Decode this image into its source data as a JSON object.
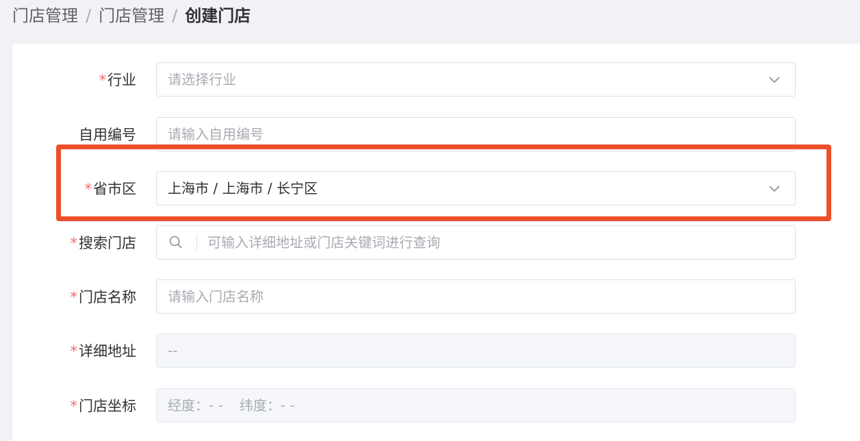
{
  "breadcrumb": {
    "items": [
      "门店管理",
      "门店管理"
    ],
    "current": "创建门店",
    "separator": "/"
  },
  "form": {
    "required_mark": "*",
    "industry": {
      "label": "行业",
      "placeholder": "请选择行业",
      "required": true
    },
    "custom_code": {
      "label": "自用编号",
      "placeholder": "请输入自用编号",
      "required": false
    },
    "region": {
      "label": "省市区",
      "value": "上海市 / 上海市 / 长宁区",
      "required": true
    },
    "search_store": {
      "label": "搜索门店",
      "placeholder": "可输入详细地址或门店关键词进行查询",
      "required": true
    },
    "store_name": {
      "label": "门店名称",
      "placeholder": "请输入门店名称",
      "required": true
    },
    "address": {
      "label": "详细地址",
      "value": "--",
      "required": true
    },
    "coordinates": {
      "label": "门店坐标",
      "longitude_text": "经度：- -",
      "latitude_text": "纬度：- -",
      "required": true
    }
  },
  "icons": {
    "dropdown": "chevron-down-icon",
    "search": "search-icon"
  },
  "colors": {
    "highlight": "#ec5029",
    "required": "#f56c6c",
    "placeholder": "#a8abb2"
  }
}
